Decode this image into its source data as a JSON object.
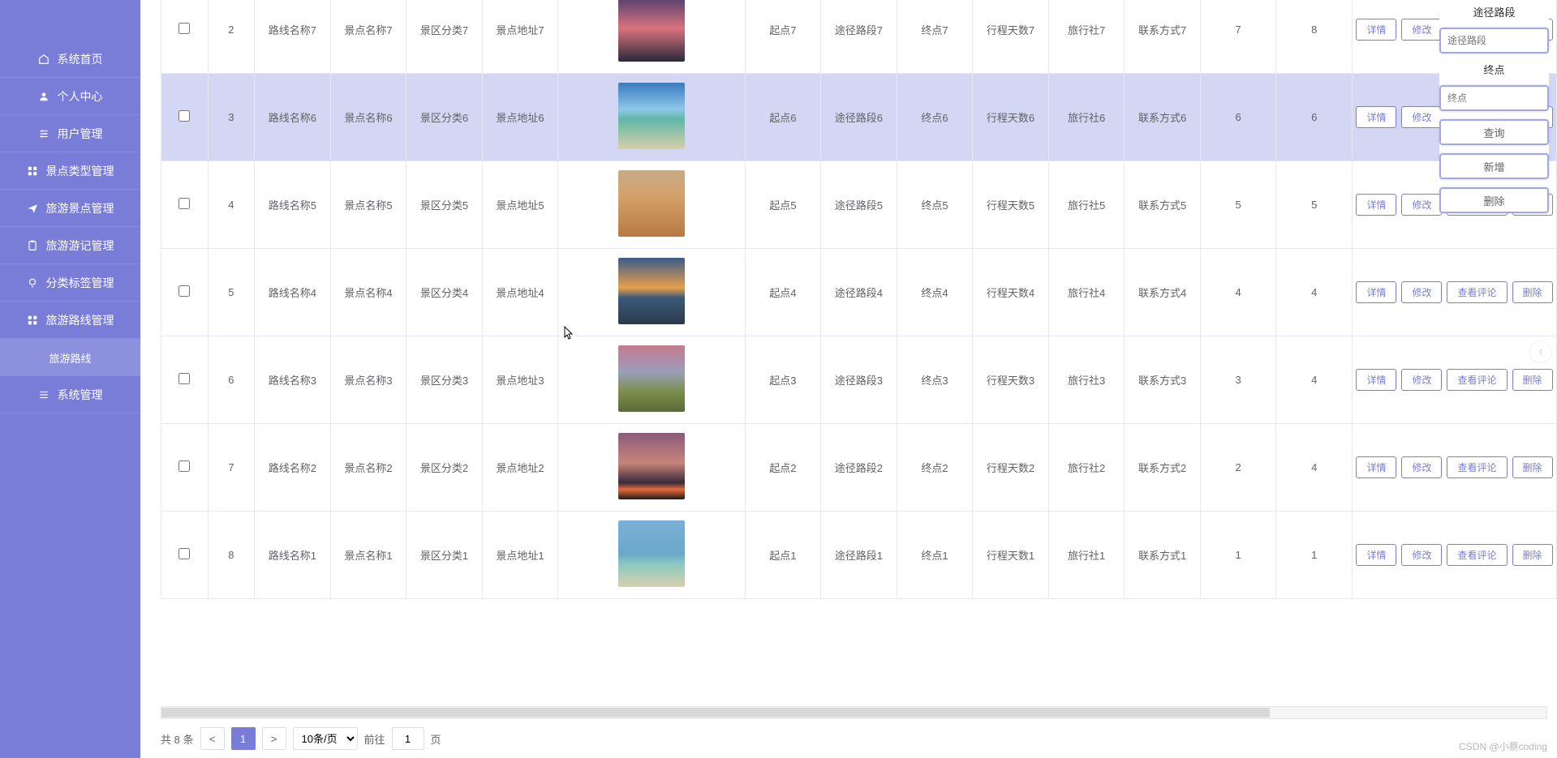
{
  "sidebar": {
    "items": [
      {
        "icon": "home",
        "label": "系统首页"
      },
      {
        "icon": "user",
        "label": "个人中心"
      },
      {
        "icon": "sliders",
        "label": "用户管理"
      },
      {
        "icon": "grid",
        "label": "景点类型管理"
      },
      {
        "icon": "plane",
        "label": "旅游景点管理"
      },
      {
        "icon": "clipboard",
        "label": "旅游游记管理"
      },
      {
        "icon": "bulb",
        "label": "分类标签管理"
      },
      {
        "icon": "route",
        "label": "旅游路线管理"
      },
      {
        "icon": "",
        "label": "旅游路线",
        "sub": true
      },
      {
        "icon": "menu",
        "label": "系统管理"
      }
    ]
  },
  "table": {
    "rows": [
      {
        "idx": "2",
        "route": "路线名称7",
        "spot": "景点名称7",
        "cat": "景区分类7",
        "addr": "景点地址7",
        "img": "sunset",
        "start": "起点7",
        "via": "途径路段7",
        "end": "终点7",
        "days": "行程天数7",
        "agency": "旅行社7",
        "contact": "联系方式7",
        "c1": "7",
        "c2": "8",
        "hl": false
      },
      {
        "idx": "3",
        "route": "路线名称6",
        "spot": "景点名称6",
        "cat": "景区分类6",
        "addr": "景点地址6",
        "img": "beach",
        "start": "起点6",
        "via": "途径路段6",
        "end": "终点6",
        "days": "行程天数6",
        "agency": "旅行社6",
        "contact": "联系方式6",
        "c1": "6",
        "c2": "6",
        "hl": true
      },
      {
        "idx": "4",
        "route": "路线名称5",
        "spot": "景点名称5",
        "cat": "景区分类5",
        "addr": "景点地址5",
        "img": "desert",
        "start": "起点5",
        "via": "途径路段5",
        "end": "终点5",
        "days": "行程天数5",
        "agency": "旅行社5",
        "contact": "联系方式5",
        "c1": "5",
        "c2": "5",
        "hl": false
      },
      {
        "idx": "5",
        "route": "路线名称4",
        "spot": "景点名称4",
        "cat": "景区分类4",
        "addr": "景点地址4",
        "img": "sky",
        "start": "起点4",
        "via": "途径路段4",
        "end": "终点4",
        "days": "行程天数4",
        "agency": "旅行社4",
        "contact": "联系方式4",
        "c1": "4",
        "c2": "4",
        "hl": false
      },
      {
        "idx": "6",
        "route": "路线名称3",
        "spot": "景点名称3",
        "cat": "景区分类3",
        "addr": "景点地址3",
        "img": "field",
        "start": "起点3",
        "via": "途径路段3",
        "end": "终点3",
        "days": "行程天数3",
        "agency": "旅行社3",
        "contact": "联系方式3",
        "c1": "3",
        "c2": "4",
        "hl": false
      },
      {
        "idx": "7",
        "route": "路线名称2",
        "spot": "景点名称2",
        "cat": "景区分类2",
        "addr": "景点地址2",
        "img": "dusk",
        "start": "起点2",
        "via": "途径路段2",
        "end": "终点2",
        "days": "行程天数2",
        "agency": "旅行社2",
        "contact": "联系方式2",
        "c1": "2",
        "c2": "4",
        "hl": false
      },
      {
        "idx": "8",
        "route": "路线名称1",
        "spot": "景点名称1",
        "cat": "景区分类1",
        "addr": "景点地址1",
        "img": "tropic",
        "start": "起点1",
        "via": "途径路段1",
        "end": "终点1",
        "days": "行程天数1",
        "agency": "旅行社1",
        "contact": "联系方式1",
        "c1": "1",
        "c2": "1",
        "hl": false
      }
    ],
    "ops": {
      "detail": "详情",
      "edit": "修改",
      "comment": "查看评论",
      "delete": "删除"
    }
  },
  "pager": {
    "total_prefix": "共",
    "total": "8",
    "total_suffix": "条",
    "prev": "<",
    "page": "1",
    "next": ">",
    "size": "10条/页",
    "goto_prefix": "前往",
    "goto": "1",
    "goto_suffix": "页"
  },
  "rpanel": {
    "f1_label": "途径路段",
    "f1_ph": "途径路段",
    "f2_label": "终点",
    "f2_ph": "终点",
    "query": "查询",
    "add": "新增",
    "del": "删除"
  },
  "watermark": "CSDN @小蔡coding"
}
